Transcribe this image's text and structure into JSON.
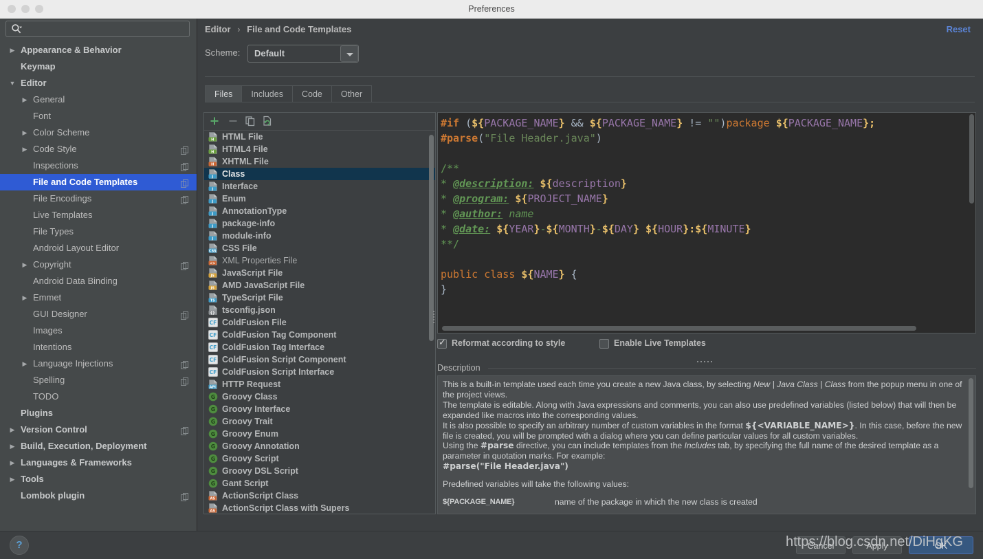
{
  "window": {
    "title": "Preferences",
    "traffic_lights": [
      "close",
      "minimize",
      "zoom"
    ]
  },
  "sidebar": {
    "search": {
      "value": "",
      "placeholder": "",
      "icon": "search-icon"
    },
    "items": [
      {
        "label": "Appearance & Behavior",
        "indent": 30,
        "arrow": "collapsed",
        "bold": true,
        "copy": false
      },
      {
        "label": "Keymap",
        "indent": 30,
        "arrow": "none",
        "bold": true,
        "copy": false
      },
      {
        "label": "Editor",
        "indent": 30,
        "arrow": "expanded",
        "bold": true,
        "copy": false
      },
      {
        "label": "General",
        "indent": 48,
        "arrow": "collapsed",
        "bold": false,
        "copy": false
      },
      {
        "label": "Font",
        "indent": 48,
        "arrow": "none",
        "bold": false,
        "copy": false
      },
      {
        "label": "Color Scheme",
        "indent": 48,
        "arrow": "collapsed",
        "bold": false,
        "copy": false
      },
      {
        "label": "Code Style",
        "indent": 48,
        "arrow": "collapsed",
        "bold": false,
        "copy": true
      },
      {
        "label": "Inspections",
        "indent": 48,
        "arrow": "none",
        "bold": false,
        "copy": true
      },
      {
        "label": "File and Code Templates",
        "indent": 48,
        "arrow": "none",
        "bold": false,
        "copy": true,
        "selected": true
      },
      {
        "label": "File Encodings",
        "indent": 48,
        "arrow": "none",
        "bold": false,
        "copy": true
      },
      {
        "label": "Live Templates",
        "indent": 48,
        "arrow": "none",
        "bold": false,
        "copy": false
      },
      {
        "label": "File Types",
        "indent": 48,
        "arrow": "none",
        "bold": false,
        "copy": false
      },
      {
        "label": "Android Layout Editor",
        "indent": 48,
        "arrow": "none",
        "bold": false,
        "copy": false
      },
      {
        "label": "Copyright",
        "indent": 48,
        "arrow": "collapsed",
        "bold": false,
        "copy": true
      },
      {
        "label": "Android Data Binding",
        "indent": 48,
        "arrow": "none",
        "bold": false,
        "copy": false
      },
      {
        "label": "Emmet",
        "indent": 48,
        "arrow": "collapsed",
        "bold": false,
        "copy": false
      },
      {
        "label": "GUI Designer",
        "indent": 48,
        "arrow": "none",
        "bold": false,
        "copy": true
      },
      {
        "label": "Images",
        "indent": 48,
        "arrow": "none",
        "bold": false,
        "copy": false
      },
      {
        "label": "Intentions",
        "indent": 48,
        "arrow": "none",
        "bold": false,
        "copy": false
      },
      {
        "label": "Language Injections",
        "indent": 48,
        "arrow": "collapsed",
        "bold": false,
        "copy": true
      },
      {
        "label": "Spelling",
        "indent": 48,
        "arrow": "none",
        "bold": false,
        "copy": true
      },
      {
        "label": "TODO",
        "indent": 48,
        "arrow": "none",
        "bold": false,
        "copy": false
      },
      {
        "label": "Plugins",
        "indent": 30,
        "arrow": "none",
        "bold": true,
        "copy": false
      },
      {
        "label": "Version Control",
        "indent": 30,
        "arrow": "collapsed",
        "bold": true,
        "copy": true
      },
      {
        "label": "Build, Execution, Deployment",
        "indent": 30,
        "arrow": "collapsed",
        "bold": true,
        "copy": false
      },
      {
        "label": "Languages & Frameworks",
        "indent": 30,
        "arrow": "collapsed",
        "bold": true,
        "copy": false
      },
      {
        "label": "Tools",
        "indent": 30,
        "arrow": "collapsed",
        "bold": true,
        "copy": false
      },
      {
        "label": "Lombok plugin",
        "indent": 30,
        "arrow": "none",
        "bold": true,
        "copy": true
      }
    ]
  },
  "header": {
    "breadcrumb_parent": "Editor",
    "breadcrumb_separator": "›",
    "breadcrumb_current": "File and Code Templates",
    "reset_label": "Reset",
    "scheme_label": "Scheme:",
    "scheme_value": "Default",
    "accent_link_color": "#5b84d6"
  },
  "tabs": [
    {
      "label": "Files",
      "active": true
    },
    {
      "label": "Includes",
      "active": false
    },
    {
      "label": "Code",
      "active": false
    },
    {
      "label": "Other",
      "active": false
    }
  ],
  "list_toolbar": [
    {
      "name": "add-icon",
      "glyph": "+"
    },
    {
      "name": "remove-icon",
      "glyph": "−"
    },
    {
      "name": "copy-icon",
      "glyph": "copy"
    },
    {
      "name": "reset-template-icon",
      "glyph": "revert"
    }
  ],
  "file_list": [
    {
      "label": "HTML File",
      "icon": "html-file-icon",
      "badge": "H",
      "badge_color": "#6a9f3f"
    },
    {
      "label": "HTML4 File",
      "icon": "html4-file-icon",
      "badge": "H",
      "badge_color": "#6a9f3f"
    },
    {
      "label": "XHTML File",
      "icon": "xhtml-file-icon",
      "badge": "H",
      "badge_color": "#cc6633"
    },
    {
      "label": "Class",
      "icon": "java-class-icon",
      "badge": "J",
      "badge_color": "#3d9bc7",
      "selected": true
    },
    {
      "label": "Interface",
      "icon": "java-interface-icon",
      "badge": "J",
      "badge_color": "#3d9bc7"
    },
    {
      "label": "Enum",
      "icon": "java-enum-icon",
      "badge": "J",
      "badge_color": "#3d9bc7"
    },
    {
      "label": "AnnotationType",
      "icon": "java-annotation-icon",
      "badge": "J",
      "badge_color": "#3d9bc7"
    },
    {
      "label": "package-info",
      "icon": "java-package-info-icon",
      "badge": "J",
      "badge_color": "#3d9bc7"
    },
    {
      "label": "module-info",
      "icon": "java-module-info-icon",
      "badge": "J",
      "badge_color": "#3d9bc7"
    },
    {
      "label": "CSS File",
      "icon": "css-file-icon",
      "badge": "CSS",
      "badge_color": "#3d9bc7"
    },
    {
      "label": "XML Properties File",
      "icon": "xml-properties-icon",
      "badge": "<>",
      "badge_color": "#cc6633",
      "plain": true
    },
    {
      "label": "JavaScript File",
      "icon": "javascript-file-icon",
      "badge": "JS",
      "badge_color": "#d6a239"
    },
    {
      "label": "AMD JavaScript File",
      "icon": "amd-javascript-icon",
      "badge": "JS",
      "badge_color": "#d6a239"
    },
    {
      "label": "TypeScript File",
      "icon": "typescript-file-icon",
      "badge": "TS",
      "badge_color": "#3d9bc7"
    },
    {
      "label": "tsconfig.json",
      "icon": "tsconfig-json-icon",
      "badge": "{}",
      "badge_color": "#8d9194"
    },
    {
      "label": "ColdFusion File",
      "icon": "coldfusion-icon",
      "badge": "CF",
      "badge_color": "#3d9bc7",
      "square": true
    },
    {
      "label": "ColdFusion Tag Component",
      "icon": "coldfusion-icon",
      "badge": "CF",
      "badge_color": "#3d9bc7",
      "square": true
    },
    {
      "label": "ColdFusion Tag Interface",
      "icon": "coldfusion-icon",
      "badge": "CF",
      "badge_color": "#3d9bc7",
      "square": true
    },
    {
      "label": "ColdFusion Script Component",
      "icon": "coldfusion-icon",
      "badge": "CF",
      "badge_color": "#3d9bc7",
      "square": true
    },
    {
      "label": "ColdFusion Script Interface",
      "icon": "coldfusion-icon",
      "badge": "CF",
      "badge_color": "#3d9bc7",
      "square": true
    },
    {
      "label": "HTTP Request",
      "icon": "http-request-icon",
      "badge": "API",
      "badge_color": "#3d9bc7"
    },
    {
      "label": "Groovy Class",
      "icon": "groovy-icon",
      "badge": "G",
      "badge_color": "#4e8c3f",
      "circle": true
    },
    {
      "label": "Groovy Interface",
      "icon": "groovy-icon",
      "badge": "G",
      "badge_color": "#4e8c3f",
      "circle": true
    },
    {
      "label": "Groovy Trait",
      "icon": "groovy-icon",
      "badge": "G",
      "badge_color": "#4e8c3f",
      "circle": true
    },
    {
      "label": "Groovy Enum",
      "icon": "groovy-icon",
      "badge": "G",
      "badge_color": "#4e8c3f",
      "circle": true
    },
    {
      "label": "Groovy Annotation",
      "icon": "groovy-icon",
      "badge": "G",
      "badge_color": "#4e8c3f",
      "circle": true
    },
    {
      "label": "Groovy Script",
      "icon": "groovy-icon",
      "badge": "G",
      "badge_color": "#4e8c3f",
      "circle": true
    },
    {
      "label": "Groovy DSL Script",
      "icon": "groovy-icon",
      "badge": "G",
      "badge_color": "#4e8c3f",
      "circle": true
    },
    {
      "label": "Gant Script",
      "icon": "gant-icon",
      "badge": "G",
      "badge_color": "#4e8c3f",
      "circle": true
    },
    {
      "label": "ActionScript Class",
      "icon": "actionscript-icon",
      "badge": "AS",
      "badge_color": "#cc6633"
    },
    {
      "label": "ActionScript Class with Supers",
      "icon": "actionscript-icon",
      "badge": "AS",
      "badge_color": "#cc6633"
    }
  ],
  "editor": {
    "lines": [
      "#if (${PACKAGE_NAME} && ${PACKAGE_NAME} != \"\")package ${PACKAGE_NAME};",
      "#parse(\"File Header.java\")",
      "",
      "/**",
      " * @description: ${description}",
      " * @program: ${PROJECT_NAME}",
      " * @author: name",
      " * @date: ${YEAR}-${MONTH}-${DAY} ${HOUR}:${MINUTE}",
      " **/",
      "",
      "public class ${NAME} {",
      "}"
    ],
    "background": "#2b2b2b"
  },
  "options": {
    "reformat": {
      "label": "Reformat according to style",
      "checked": true
    },
    "live_templates": {
      "label": "Enable Live Templates",
      "checked": false
    }
  },
  "description": {
    "title": "Description",
    "p1_a": "This is a built-in template used each time you create a new Java class, by selecting ",
    "p1_i1": "New | Java Class | Class",
    "p1_b": " from the popup menu in one of the project views.",
    "p2": "The template is editable. Along with Java expressions and comments, you can also use predefined variables (listed below) that will then be expanded like macros into the corresponding values.",
    "p3_a": "It is also possible to specify an arbitrary number of custom variables in the format ",
    "p3_code": "${<VARIABLE_NAME>}",
    "p3_b": ". In this case, before the new file is created, you will be prompted with a dialog where you can define particular values for all custom variables.",
    "p4_a": "Using the ",
    "p4_code": "#parse",
    "p4_b": " directive, you can include templates from the ",
    "p4_i": "Includes",
    "p4_c": " tab, by specifying the full name of the desired template as a parameter in quotation marks. For example:",
    "p5_code": "#parse(\"File Header.java\")",
    "p6": "Predefined variables will take the following values:",
    "vars": [
      {
        "name": "${PACKAGE_NAME}",
        "desc": "name of the package in which the new class is created"
      }
    ]
  },
  "footer": {
    "help_label": "?",
    "cancel_label": "Cancel",
    "apply_label": "Apply",
    "ok_label": "OK",
    "ok_color": "#365880"
  },
  "watermark": "https://blog.csdn.net/DiHgKG"
}
